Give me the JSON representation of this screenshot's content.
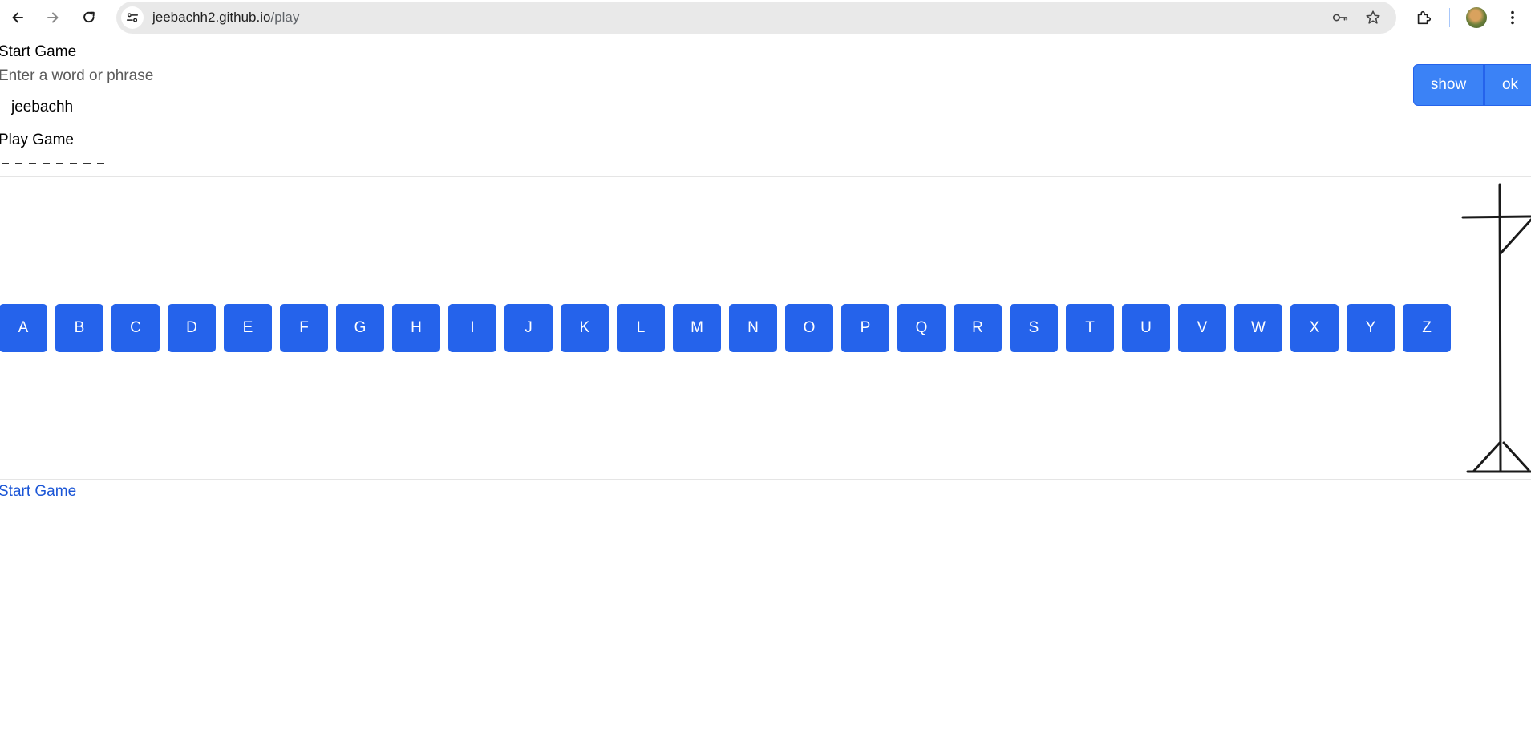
{
  "browser": {
    "url_host": "jeebachh2.github.io",
    "url_path": "/play",
    "icons": [
      "back-icon",
      "forward-icon",
      "reload-icon",
      "site-info-icon",
      "password-key-icon",
      "bookmark-star-icon",
      "extensions-icon",
      "profile-avatar",
      "menu-dots-icon"
    ]
  },
  "setup": {
    "heading": "Start Game",
    "prompt": "Enter a word or phrase",
    "input_value": "jeebachh",
    "show_label": "show",
    "ok_label": "ok"
  },
  "play": {
    "heading": "Play Game",
    "blanks": [
      "_",
      "_",
      "_",
      "_",
      "_",
      "_",
      "_",
      "_"
    ],
    "letters": [
      "A",
      "B",
      "C",
      "D",
      "E",
      "F",
      "G",
      "H",
      "I",
      "J",
      "K",
      "L",
      "M",
      "N",
      "O",
      "P",
      "Q",
      "R",
      "S",
      "T",
      "U",
      "V",
      "W",
      "X",
      "Y",
      "Z"
    ]
  },
  "footer": {
    "start_link": "Start Game"
  },
  "colors": {
    "letter_button": "#2563eb",
    "top_button": "#3b82f6",
    "link": "#1a55d6"
  }
}
